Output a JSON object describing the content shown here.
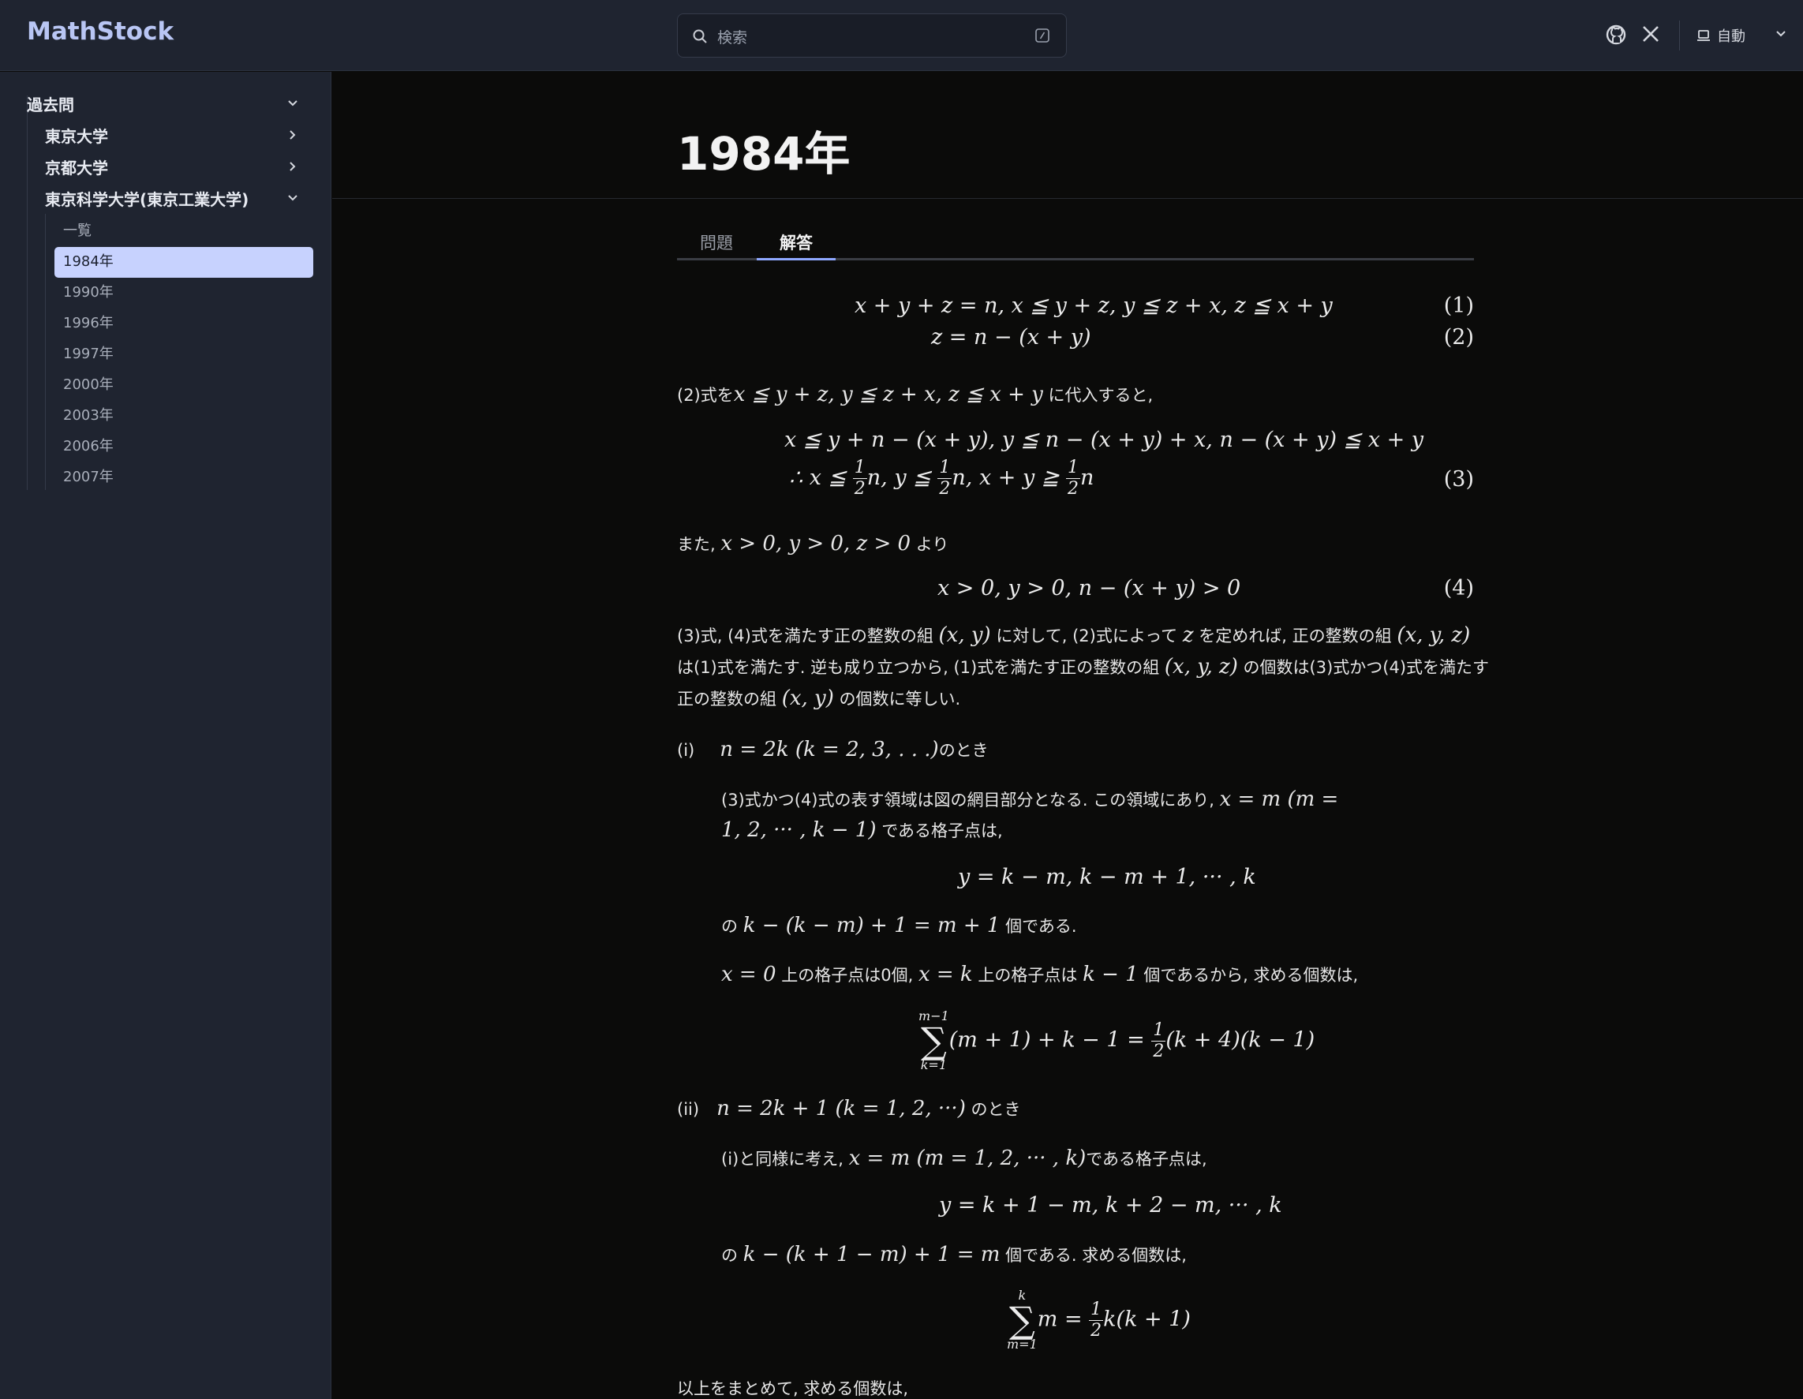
{
  "header": {
    "logo": "MathStock",
    "search_placeholder": "検索",
    "theme_label": "自動"
  },
  "sidebar": {
    "section": "過去問",
    "groups": [
      {
        "label": "東京大学"
      },
      {
        "label": "京都大学"
      },
      {
        "label": "東京科学大学(東京工業大学)"
      }
    ],
    "items": [
      "一覧",
      "1984年",
      "1990年",
      "1996年",
      "1997年",
      "2000年",
      "2003年",
      "2006年",
      "2007年"
    ],
    "active_item": "1984年"
  },
  "page": {
    "title": "1984年",
    "tabs": [
      "問題",
      "解答"
    ],
    "active_tab": "解答"
  },
  "content": {
    "eq1": "x + y + z = n, x ≦ y + z, y ≦ z + x, z ≦ x + y",
    "eq1_tag": "(1)",
    "eq2": "z = n − (x + y)",
    "eq2_tag": "(2)",
    "p1_a": "(2)式を",
    "p1_m": "x ≦ y + z,  y ≦ z + x,  z ≦ x + y",
    "p1_b": "に代入すると,",
    "eq3a": "x ≦ y + n − (x + y), y ≦ n − (x + y) + x, n − (x + y) ≦ x + y",
    "eq3b_pre": "∴ x ≦",
    "eq3b_mid1": "n, y ≦",
    "eq3b_mid2": "n, x + y ≧",
    "eq3b_post": "n",
    "half_num": "1",
    "half_den": "2",
    "eq3_tag": "(3)",
    "p2_a": "また,",
    "p2_m": "x > 0, y > 0, z > 0",
    "p2_b": "より",
    "eq4": "x > 0, y > 0, n − (x + y) > 0",
    "eq4_tag": "(4)",
    "p3_l1_a": "(3)式, (4)式を満たす正の整数の組",
    "p3_l1_m1": "(x, y)",
    "p3_l1_b": "に対して, (2)式によって",
    "p3_l1_m2": "z",
    "p3_l1_c": "を定めれば, 正の整数の組",
    "p3_l1_m3": "(x, y, z)",
    "p3_l2_a": "は(1)式を満たす. 逆も成り立つから, (1)式を満たす正の整数の組",
    "p3_l2_m": "(x, y, z)",
    "p3_l2_b": "の個数は(3)式かつ(4)式を満たす",
    "p3_l3_a": "正の整数の組",
    "p3_l3_m": "(x, y)",
    "p3_l3_b": "の個数に等しい.",
    "case1_label": "(i)",
    "case1_m": "n = 2k (k = 2, 3, . . .)",
    "case1_b": "のとき",
    "c1_l1_a": "(3)式かつ(4)式の表す領域は図の網目部分となる. この領域にあり,",
    "c1_l1_m": "x = m   (m =",
    "c1_l2_m": "1, 2, ··· , k − 1)",
    "c1_l2_b": "である格子点は,",
    "c1_eq1": "y = k − m, k − m + 1, ··· , k",
    "c1_l3_a": "の",
    "c1_l3_m": "k − (k − m) + 1 = m + 1",
    "c1_l3_b": "個である.",
    "c1_l4_m1": "x = 0",
    "c1_l4_a": "上の格子点は0個,",
    "c1_l4_m2": "x = k",
    "c1_l4_b": "上の格子点は",
    "c1_l4_m3": "k − 1",
    "c1_l4_c": "個であるから, 求める個数は,",
    "c1_sum_top": "m−1",
    "c1_sum_bot": "k=1",
    "c1_sum_expr_a": "(m + 1) + k − 1 =",
    "c1_sum_expr_b": "(k + 4)(k − 1)",
    "case2_label": "(ii)",
    "case2_m": "n = 2k + 1   (k = 1, 2, ···)",
    "case2_b": "のとき",
    "c2_l1_a": "(i)と同様に考え,",
    "c2_l1_m": "x = m   (m = 1, 2, ··· , k)",
    "c2_l1_b": "である格子点は,",
    "c2_eq1": "y = k + 1 − m, k + 2 − m, ··· , k",
    "c2_l2_a": "の",
    "c2_l2_m": "k − (k + 1 − m) + 1 = m",
    "c2_l2_b": "個である. 求める個数は,",
    "c2_sum_top": "k",
    "c2_sum_bot": "m=1",
    "c2_sum_expr_a": "m =",
    "c2_sum_expr_b": "k(k + 1)",
    "final": "以上をまとめて, 求める個数は,"
  },
  "colors": {
    "header_bg": "#1f2430",
    "page_bg": "#0b0b0a",
    "accent": "#b9c6f4",
    "active_item_bg": "#c7d2fe"
  }
}
